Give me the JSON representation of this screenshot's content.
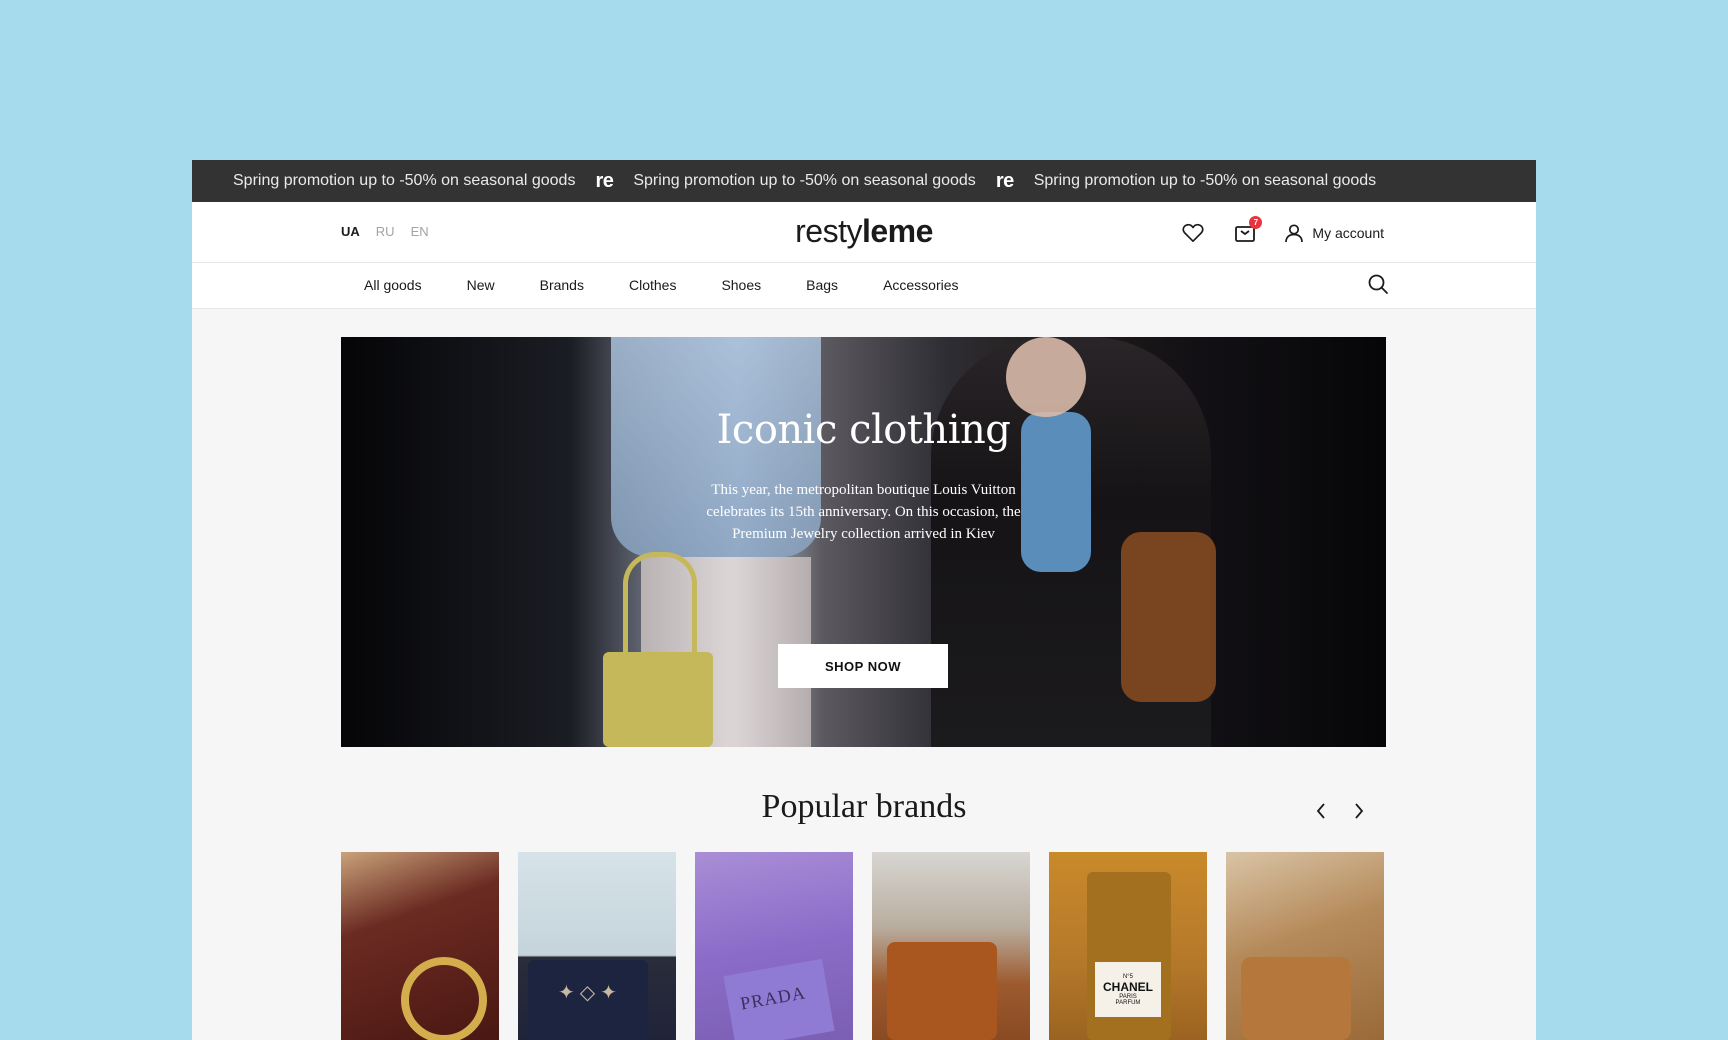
{
  "promo": {
    "message": "Spring promotion up to -50% on seasonal goods",
    "logo_mark": "re",
    "repeat": 3
  },
  "header": {
    "languages": [
      "UA",
      "RU",
      "EN"
    ],
    "active_language": "UA",
    "logo_light": "resty",
    "logo_bold": "leme",
    "cart_count": "7",
    "account_label": "My account"
  },
  "nav": {
    "items": [
      "All goods",
      "New",
      "Brands",
      "Clothes",
      "Shoes",
      "Bags",
      "Accessories"
    ]
  },
  "hero": {
    "title": "Iconic clothing",
    "text": "This year, the metropolitan boutique Louis Vuitton celebrates its 15th anniversary. On this occasion, the Premium Jewelry collection arrived in Kiev",
    "button_label": "SHOP NOW"
  },
  "popular": {
    "title": "Popular brands",
    "brands": [
      {
        "image": "gucci-bag"
      },
      {
        "image": "louis-vuitton-bag"
      },
      {
        "image": "prada-bag",
        "label": "PRADA"
      },
      {
        "image": "hermes-bag"
      },
      {
        "image": "chanel-perfume",
        "label": "CHANEL",
        "sublabel": "N°5",
        "label_small": "PARIS",
        "label_small2": "PARFUM"
      },
      {
        "image": "fendi-bag"
      }
    ]
  },
  "colors": {
    "page_bg": "#a6dbee",
    "promo_bg": "#333333",
    "badge": "#e8343f"
  }
}
